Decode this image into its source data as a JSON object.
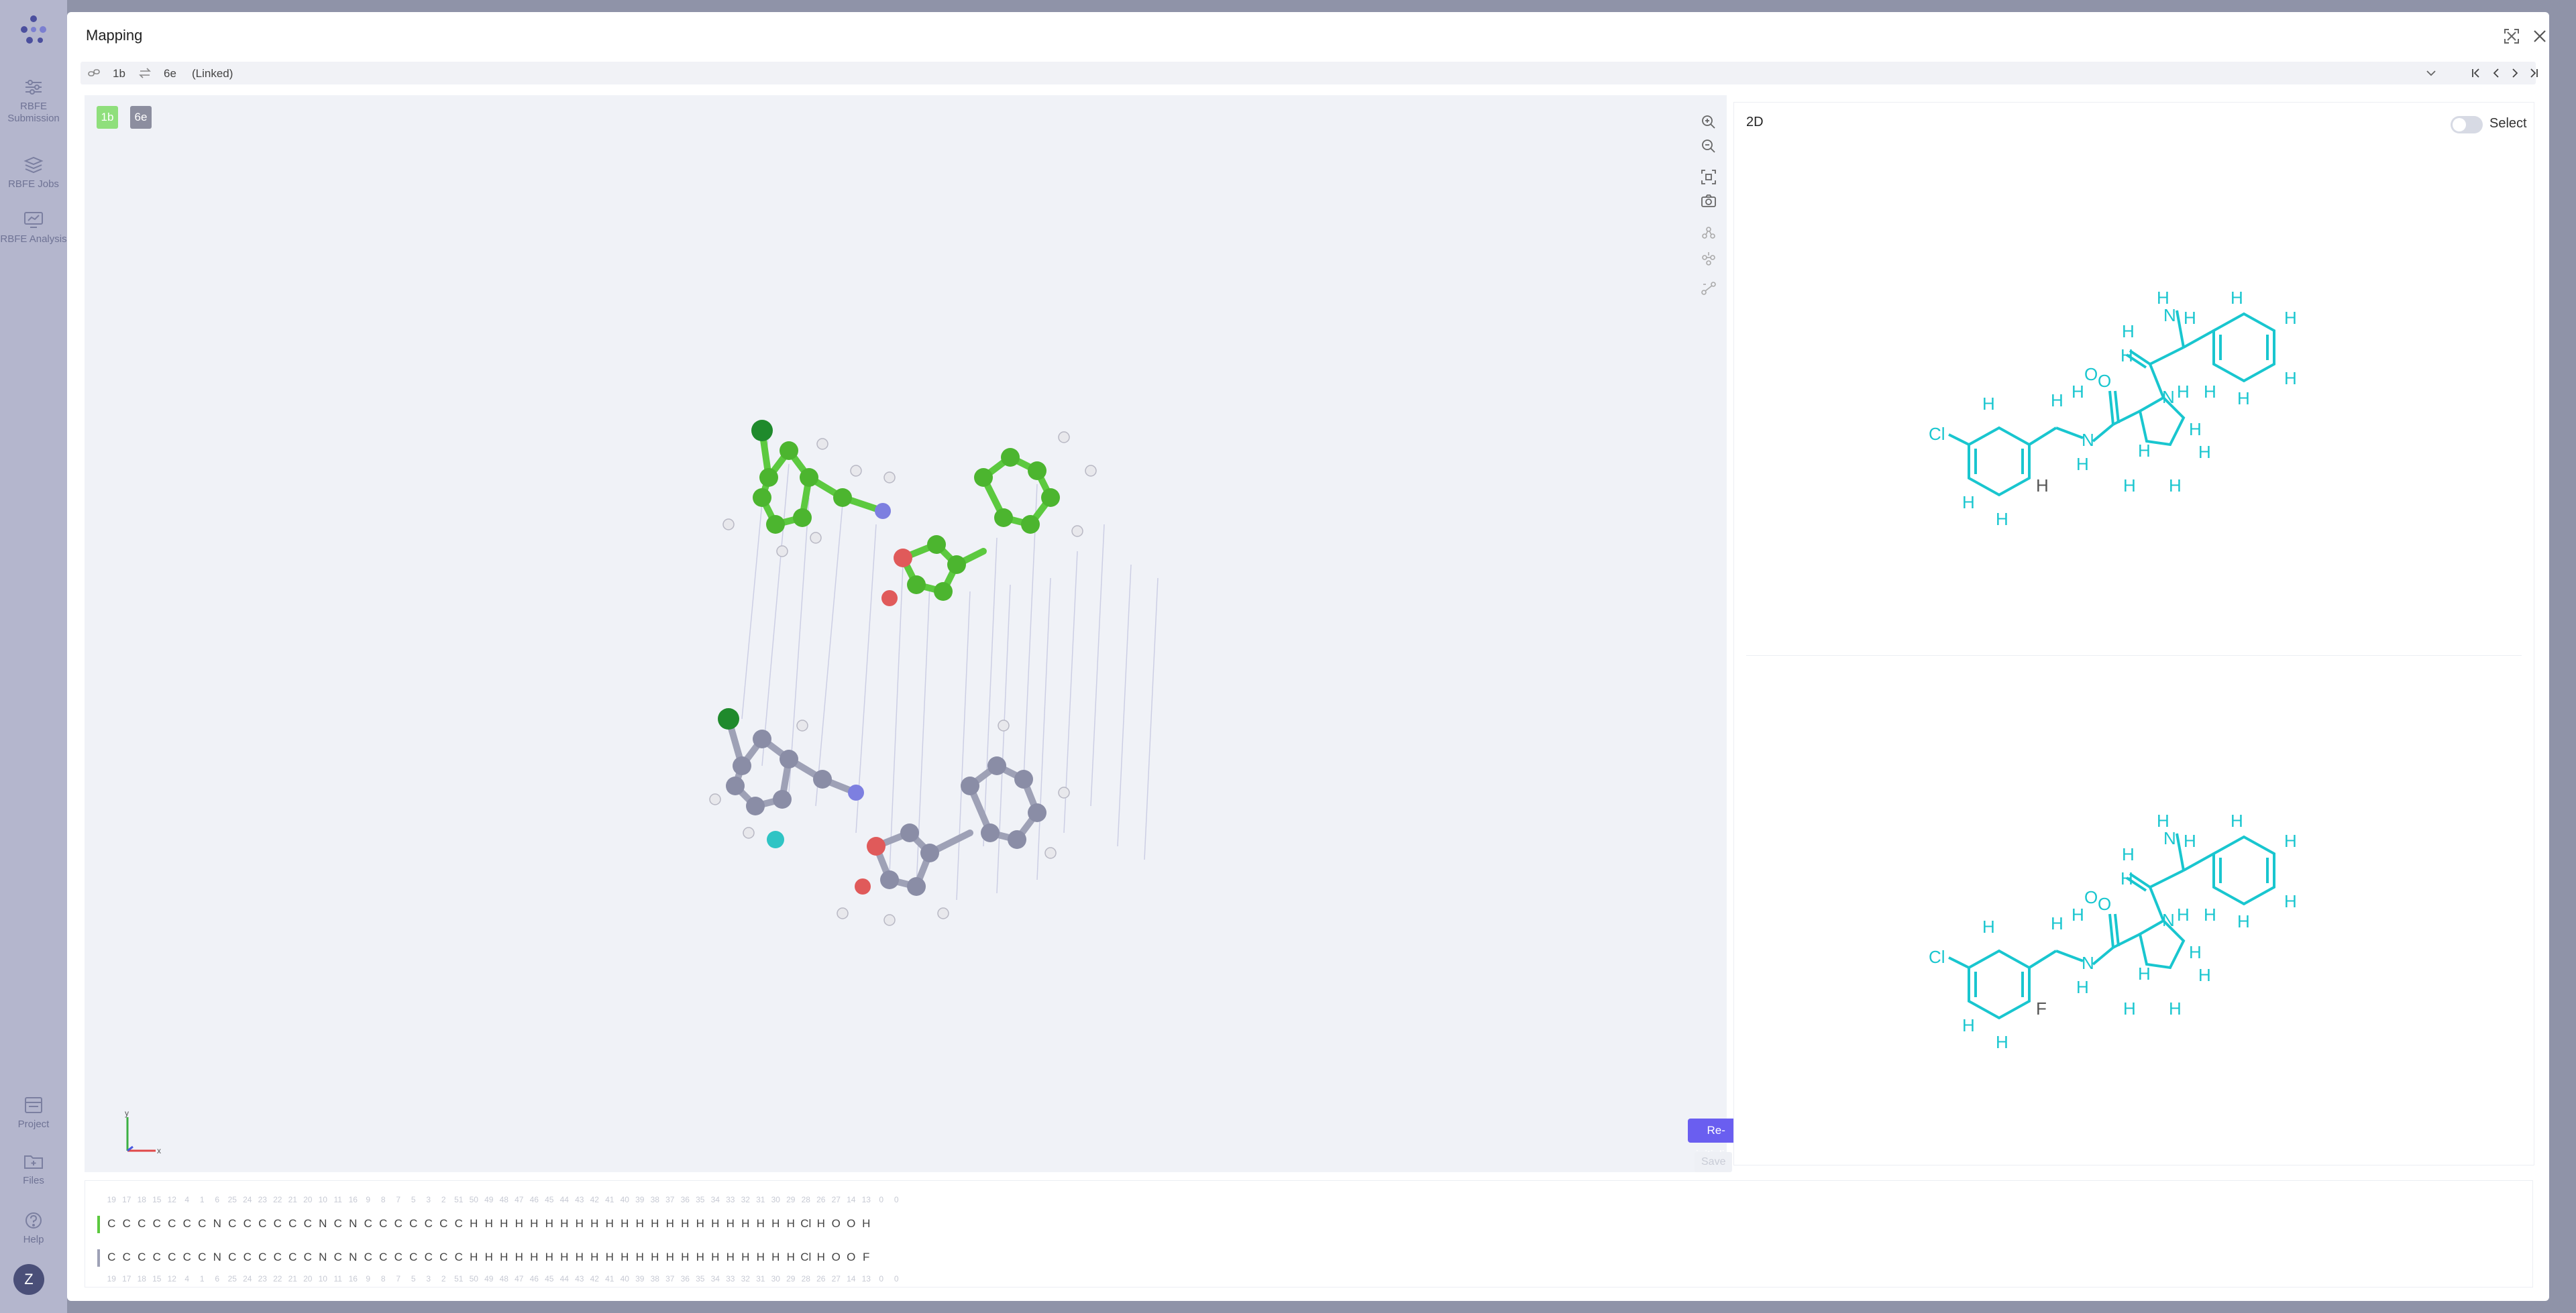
{
  "rail": {
    "items": [
      {
        "label": "RBFE Submission",
        "icon": "sliders-icon"
      },
      {
        "label": "RBFE Jobs",
        "icon": "layers-icon"
      },
      {
        "label": "RBFE Analysis",
        "icon": "monitor-chart-icon"
      }
    ],
    "bottom_items": [
      {
        "label": "Project",
        "icon": "project-icon"
      },
      {
        "label": "Files",
        "icon": "folder-icon"
      },
      {
        "label": "Help",
        "icon": "help-icon"
      }
    ],
    "avatar": "Z"
  },
  "modal": {
    "title": "Mapping"
  },
  "pair": {
    "ligand_a": "1b",
    "ligand_b": "6e",
    "status": "(Linked)"
  },
  "viewer": {
    "tag_a": "1b",
    "tag_b": "6e",
    "reinit_label": "Re-initialize",
    "save_label": "Save",
    "axis_x": "x",
    "axis_y": "y",
    "colors": {
      "ligand_a": "#5cc93f",
      "ligand_b": "#9ea1b6",
      "accent": "#6a5ef0"
    }
  },
  "panel2d": {
    "title": "2D",
    "select_label": "Select",
    "mol_color": "#19c6cf"
  },
  "sequence": {
    "numbers_top": [
      "19",
      "17",
      "18",
      "15",
      "12",
      "4",
      "1",
      "6",
      "25",
      "24",
      "23",
      "22",
      "21",
      "20",
      "10",
      "11",
      "16",
      "9",
      "8",
      "7",
      "5",
      "3",
      "2",
      "51",
      "50",
      "49",
      "48",
      "47",
      "46",
      "45",
      "44",
      "43",
      "42",
      "41",
      "40",
      "39",
      "38",
      "37",
      "36",
      "35",
      "34",
      "33",
      "32",
      "31",
      "30",
      "29",
      "28",
      "26",
      "27",
      "14",
      "13",
      "0",
      "0"
    ],
    "row_a": [
      "C",
      "C",
      "C",
      "C",
      "C",
      "C",
      "C",
      "N",
      "C",
      "C",
      "C",
      "C",
      "C",
      "C",
      "N",
      "C",
      "N",
      "C",
      "C",
      "C",
      "C",
      "C",
      "C",
      "C",
      "H",
      "H",
      "H",
      "H",
      "H",
      "H",
      "H",
      "H",
      "H",
      "H",
      "H",
      "H",
      "H",
      "H",
      "H",
      "H",
      "H",
      "H",
      "H",
      "H",
      "H",
      "H",
      "Cl",
      "H",
      "O",
      "O",
      "H"
    ],
    "row_b": [
      "C",
      "C",
      "C",
      "C",
      "C",
      "C",
      "C",
      "N",
      "C",
      "C",
      "C",
      "C",
      "C",
      "C",
      "N",
      "C",
      "N",
      "C",
      "C",
      "C",
      "C",
      "C",
      "C",
      "C",
      "H",
      "H",
      "H",
      "H",
      "H",
      "H",
      "H",
      "H",
      "H",
      "H",
      "H",
      "H",
      "H",
      "H",
      "H",
      "H",
      "H",
      "H",
      "H",
      "H",
      "H",
      "H",
      "Cl",
      "H",
      "O",
      "O",
      "F"
    ],
    "numbers_bottom": [
      "19",
      "17",
      "18",
      "15",
      "12",
      "4",
      "1",
      "6",
      "25",
      "24",
      "23",
      "22",
      "21",
      "20",
      "10",
      "11",
      "16",
      "9",
      "8",
      "7",
      "5",
      "3",
      "2",
      "51",
      "50",
      "49",
      "48",
      "47",
      "46",
      "45",
      "44",
      "43",
      "42",
      "41",
      "40",
      "39",
      "38",
      "37",
      "36",
      "35",
      "34",
      "33",
      "32",
      "31",
      "30",
      "29",
      "28",
      "26",
      "27",
      "14",
      "13",
      "0",
      "0"
    ]
  }
}
